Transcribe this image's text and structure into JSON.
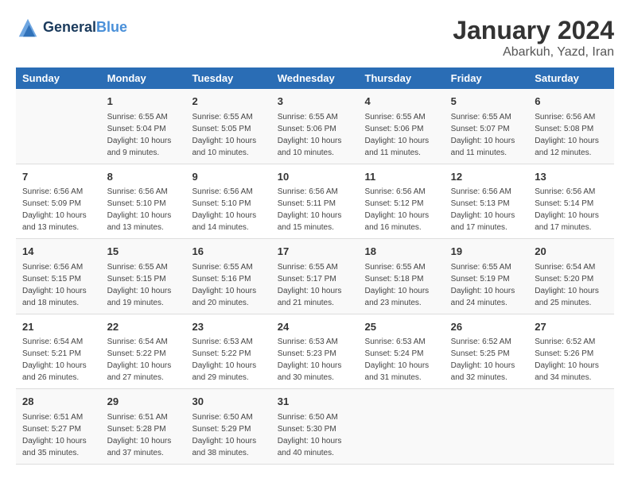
{
  "header": {
    "logo_line1": "General",
    "logo_line2": "Blue",
    "month": "January 2024",
    "location": "Abarkuh, Yazd, Iran"
  },
  "columns": [
    "Sunday",
    "Monday",
    "Tuesday",
    "Wednesday",
    "Thursday",
    "Friday",
    "Saturday"
  ],
  "weeks": [
    [
      {
        "day": "",
        "sunrise": "",
        "sunset": "",
        "daylight": ""
      },
      {
        "day": "1",
        "sunrise": "Sunrise: 6:55 AM",
        "sunset": "Sunset: 5:04 PM",
        "daylight": "Daylight: 10 hours and 9 minutes."
      },
      {
        "day": "2",
        "sunrise": "Sunrise: 6:55 AM",
        "sunset": "Sunset: 5:05 PM",
        "daylight": "Daylight: 10 hours and 10 minutes."
      },
      {
        "day": "3",
        "sunrise": "Sunrise: 6:55 AM",
        "sunset": "Sunset: 5:06 PM",
        "daylight": "Daylight: 10 hours and 10 minutes."
      },
      {
        "day": "4",
        "sunrise": "Sunrise: 6:55 AM",
        "sunset": "Sunset: 5:06 PM",
        "daylight": "Daylight: 10 hours and 11 minutes."
      },
      {
        "day": "5",
        "sunrise": "Sunrise: 6:55 AM",
        "sunset": "Sunset: 5:07 PM",
        "daylight": "Daylight: 10 hours and 11 minutes."
      },
      {
        "day": "6",
        "sunrise": "Sunrise: 6:56 AM",
        "sunset": "Sunset: 5:08 PM",
        "daylight": "Daylight: 10 hours and 12 minutes."
      }
    ],
    [
      {
        "day": "7",
        "sunrise": "Sunrise: 6:56 AM",
        "sunset": "Sunset: 5:09 PM",
        "daylight": "Daylight: 10 hours and 13 minutes."
      },
      {
        "day": "8",
        "sunrise": "Sunrise: 6:56 AM",
        "sunset": "Sunset: 5:10 PM",
        "daylight": "Daylight: 10 hours and 13 minutes."
      },
      {
        "day": "9",
        "sunrise": "Sunrise: 6:56 AM",
        "sunset": "Sunset: 5:10 PM",
        "daylight": "Daylight: 10 hours and 14 minutes."
      },
      {
        "day": "10",
        "sunrise": "Sunrise: 6:56 AM",
        "sunset": "Sunset: 5:11 PM",
        "daylight": "Daylight: 10 hours and 15 minutes."
      },
      {
        "day": "11",
        "sunrise": "Sunrise: 6:56 AM",
        "sunset": "Sunset: 5:12 PM",
        "daylight": "Daylight: 10 hours and 16 minutes."
      },
      {
        "day": "12",
        "sunrise": "Sunrise: 6:56 AM",
        "sunset": "Sunset: 5:13 PM",
        "daylight": "Daylight: 10 hours and 17 minutes."
      },
      {
        "day": "13",
        "sunrise": "Sunrise: 6:56 AM",
        "sunset": "Sunset: 5:14 PM",
        "daylight": "Daylight: 10 hours and 17 minutes."
      }
    ],
    [
      {
        "day": "14",
        "sunrise": "Sunrise: 6:56 AM",
        "sunset": "Sunset: 5:15 PM",
        "daylight": "Daylight: 10 hours and 18 minutes."
      },
      {
        "day": "15",
        "sunrise": "Sunrise: 6:55 AM",
        "sunset": "Sunset: 5:15 PM",
        "daylight": "Daylight: 10 hours and 19 minutes."
      },
      {
        "day": "16",
        "sunrise": "Sunrise: 6:55 AM",
        "sunset": "Sunset: 5:16 PM",
        "daylight": "Daylight: 10 hours and 20 minutes."
      },
      {
        "day": "17",
        "sunrise": "Sunrise: 6:55 AM",
        "sunset": "Sunset: 5:17 PM",
        "daylight": "Daylight: 10 hours and 21 minutes."
      },
      {
        "day": "18",
        "sunrise": "Sunrise: 6:55 AM",
        "sunset": "Sunset: 5:18 PM",
        "daylight": "Daylight: 10 hours and 23 minutes."
      },
      {
        "day": "19",
        "sunrise": "Sunrise: 6:55 AM",
        "sunset": "Sunset: 5:19 PM",
        "daylight": "Daylight: 10 hours and 24 minutes."
      },
      {
        "day": "20",
        "sunrise": "Sunrise: 6:54 AM",
        "sunset": "Sunset: 5:20 PM",
        "daylight": "Daylight: 10 hours and 25 minutes."
      }
    ],
    [
      {
        "day": "21",
        "sunrise": "Sunrise: 6:54 AM",
        "sunset": "Sunset: 5:21 PM",
        "daylight": "Daylight: 10 hours and 26 minutes."
      },
      {
        "day": "22",
        "sunrise": "Sunrise: 6:54 AM",
        "sunset": "Sunset: 5:22 PM",
        "daylight": "Daylight: 10 hours and 27 minutes."
      },
      {
        "day": "23",
        "sunrise": "Sunrise: 6:53 AM",
        "sunset": "Sunset: 5:22 PM",
        "daylight": "Daylight: 10 hours and 29 minutes."
      },
      {
        "day": "24",
        "sunrise": "Sunrise: 6:53 AM",
        "sunset": "Sunset: 5:23 PM",
        "daylight": "Daylight: 10 hours and 30 minutes."
      },
      {
        "day": "25",
        "sunrise": "Sunrise: 6:53 AM",
        "sunset": "Sunset: 5:24 PM",
        "daylight": "Daylight: 10 hours and 31 minutes."
      },
      {
        "day": "26",
        "sunrise": "Sunrise: 6:52 AM",
        "sunset": "Sunset: 5:25 PM",
        "daylight": "Daylight: 10 hours and 32 minutes."
      },
      {
        "day": "27",
        "sunrise": "Sunrise: 6:52 AM",
        "sunset": "Sunset: 5:26 PM",
        "daylight": "Daylight: 10 hours and 34 minutes."
      }
    ],
    [
      {
        "day": "28",
        "sunrise": "Sunrise: 6:51 AM",
        "sunset": "Sunset: 5:27 PM",
        "daylight": "Daylight: 10 hours and 35 minutes."
      },
      {
        "day": "29",
        "sunrise": "Sunrise: 6:51 AM",
        "sunset": "Sunset: 5:28 PM",
        "daylight": "Daylight: 10 hours and 37 minutes."
      },
      {
        "day": "30",
        "sunrise": "Sunrise: 6:50 AM",
        "sunset": "Sunset: 5:29 PM",
        "daylight": "Daylight: 10 hours and 38 minutes."
      },
      {
        "day": "31",
        "sunrise": "Sunrise: 6:50 AM",
        "sunset": "Sunset: 5:30 PM",
        "daylight": "Daylight: 10 hours and 40 minutes."
      },
      {
        "day": "",
        "sunrise": "",
        "sunset": "",
        "daylight": ""
      },
      {
        "day": "",
        "sunrise": "",
        "sunset": "",
        "daylight": ""
      },
      {
        "day": "",
        "sunrise": "",
        "sunset": "",
        "daylight": ""
      }
    ]
  ]
}
